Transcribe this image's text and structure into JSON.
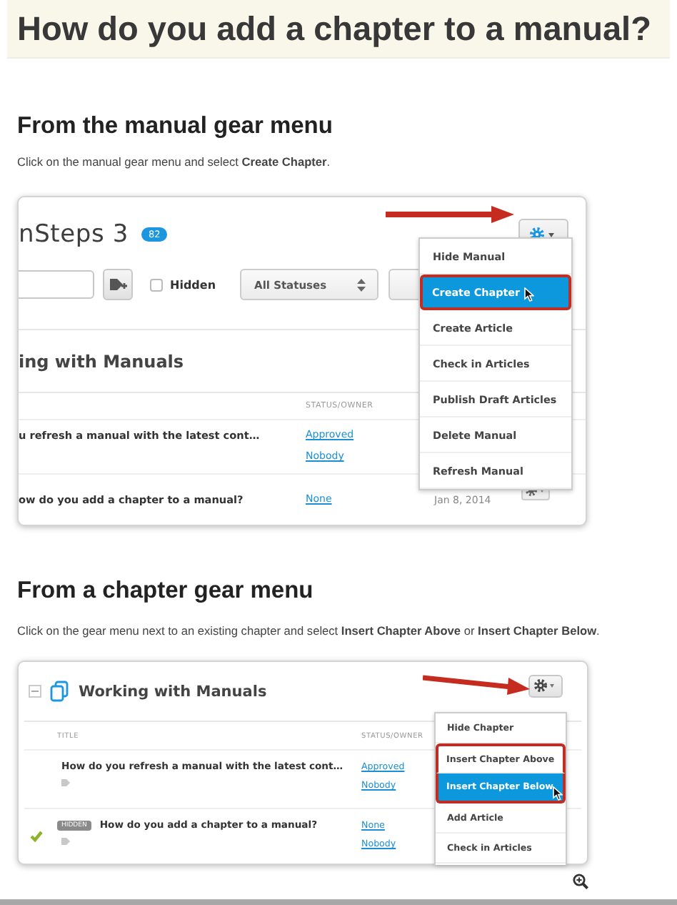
{
  "title": "How do you add a chapter to a manual?",
  "sections": [
    {
      "kind": "manual",
      "heading": "From the manual gear menu",
      "instruction": "Click on the manual gear menu and select **Create Chapter**.",
      "screenshot": {
        "product_title": "nSteps 3",
        "badge": "82",
        "hidden_filter": {
          "label": "Hidden",
          "checked": false
        },
        "status_filter": "All Statuses",
        "chapter_title": "ing with Manuals",
        "columns": [
          "STATUS/OWNER"
        ],
        "rows": [
          {
            "title": "u refresh a manual with the latest cont…",
            "status": "Approved",
            "owner": "Nobody"
          },
          {
            "title": "ow do you add a chapter to a manual?",
            "status": "None",
            "date": "Jan 8, 2014"
          }
        ],
        "menu": [
          {
            "label": "Hide Manual",
            "selected": false,
            "outlined": false
          },
          {
            "label": "Create Chapter",
            "selected": true,
            "outlined": true
          },
          {
            "label": "Create Article",
            "selected": false,
            "outlined": false
          },
          {
            "label": "Check in Articles",
            "selected": false,
            "outlined": false
          },
          {
            "label": "Publish Draft Articles",
            "selected": false,
            "outlined": false
          },
          {
            "label": "Delete Manual",
            "selected": false,
            "outlined": false
          },
          {
            "label": "Refresh Manual",
            "selected": false,
            "outlined": false
          }
        ]
      }
    },
    {
      "kind": "chapter",
      "heading": "From a chapter gear menu",
      "instruction": "Click on the gear menu next to an existing chapter and select **Insert Chapter Above** or **Insert Chapter Below**.",
      "screenshot": {
        "chapter_title": "Working with Manuals",
        "columns": [
          "TITLE",
          "STATUS/OWNER"
        ],
        "rows": [
          {
            "title": "How do you refresh a manual with the latest cont…",
            "status": "Approved",
            "owner": "Nobody",
            "checked": false
          },
          {
            "title": "How do you add a chapter to a manual?",
            "badge": "HIDDEN",
            "status": "None",
            "owner": "Nobody",
            "checked": true
          }
        ],
        "menu": [
          {
            "label": "Hide Chapter",
            "selected": false,
            "outlined": false
          },
          {
            "label": "Insert Chapter Above",
            "selected": false,
            "outlined": true
          },
          {
            "label": "Insert Chapter Below",
            "selected": true,
            "outlined": true
          },
          {
            "label": "Add Article",
            "selected": false,
            "outlined": false
          },
          {
            "label": "Check in Articles",
            "selected": false,
            "outlined": false
          }
        ]
      }
    }
  ]
}
